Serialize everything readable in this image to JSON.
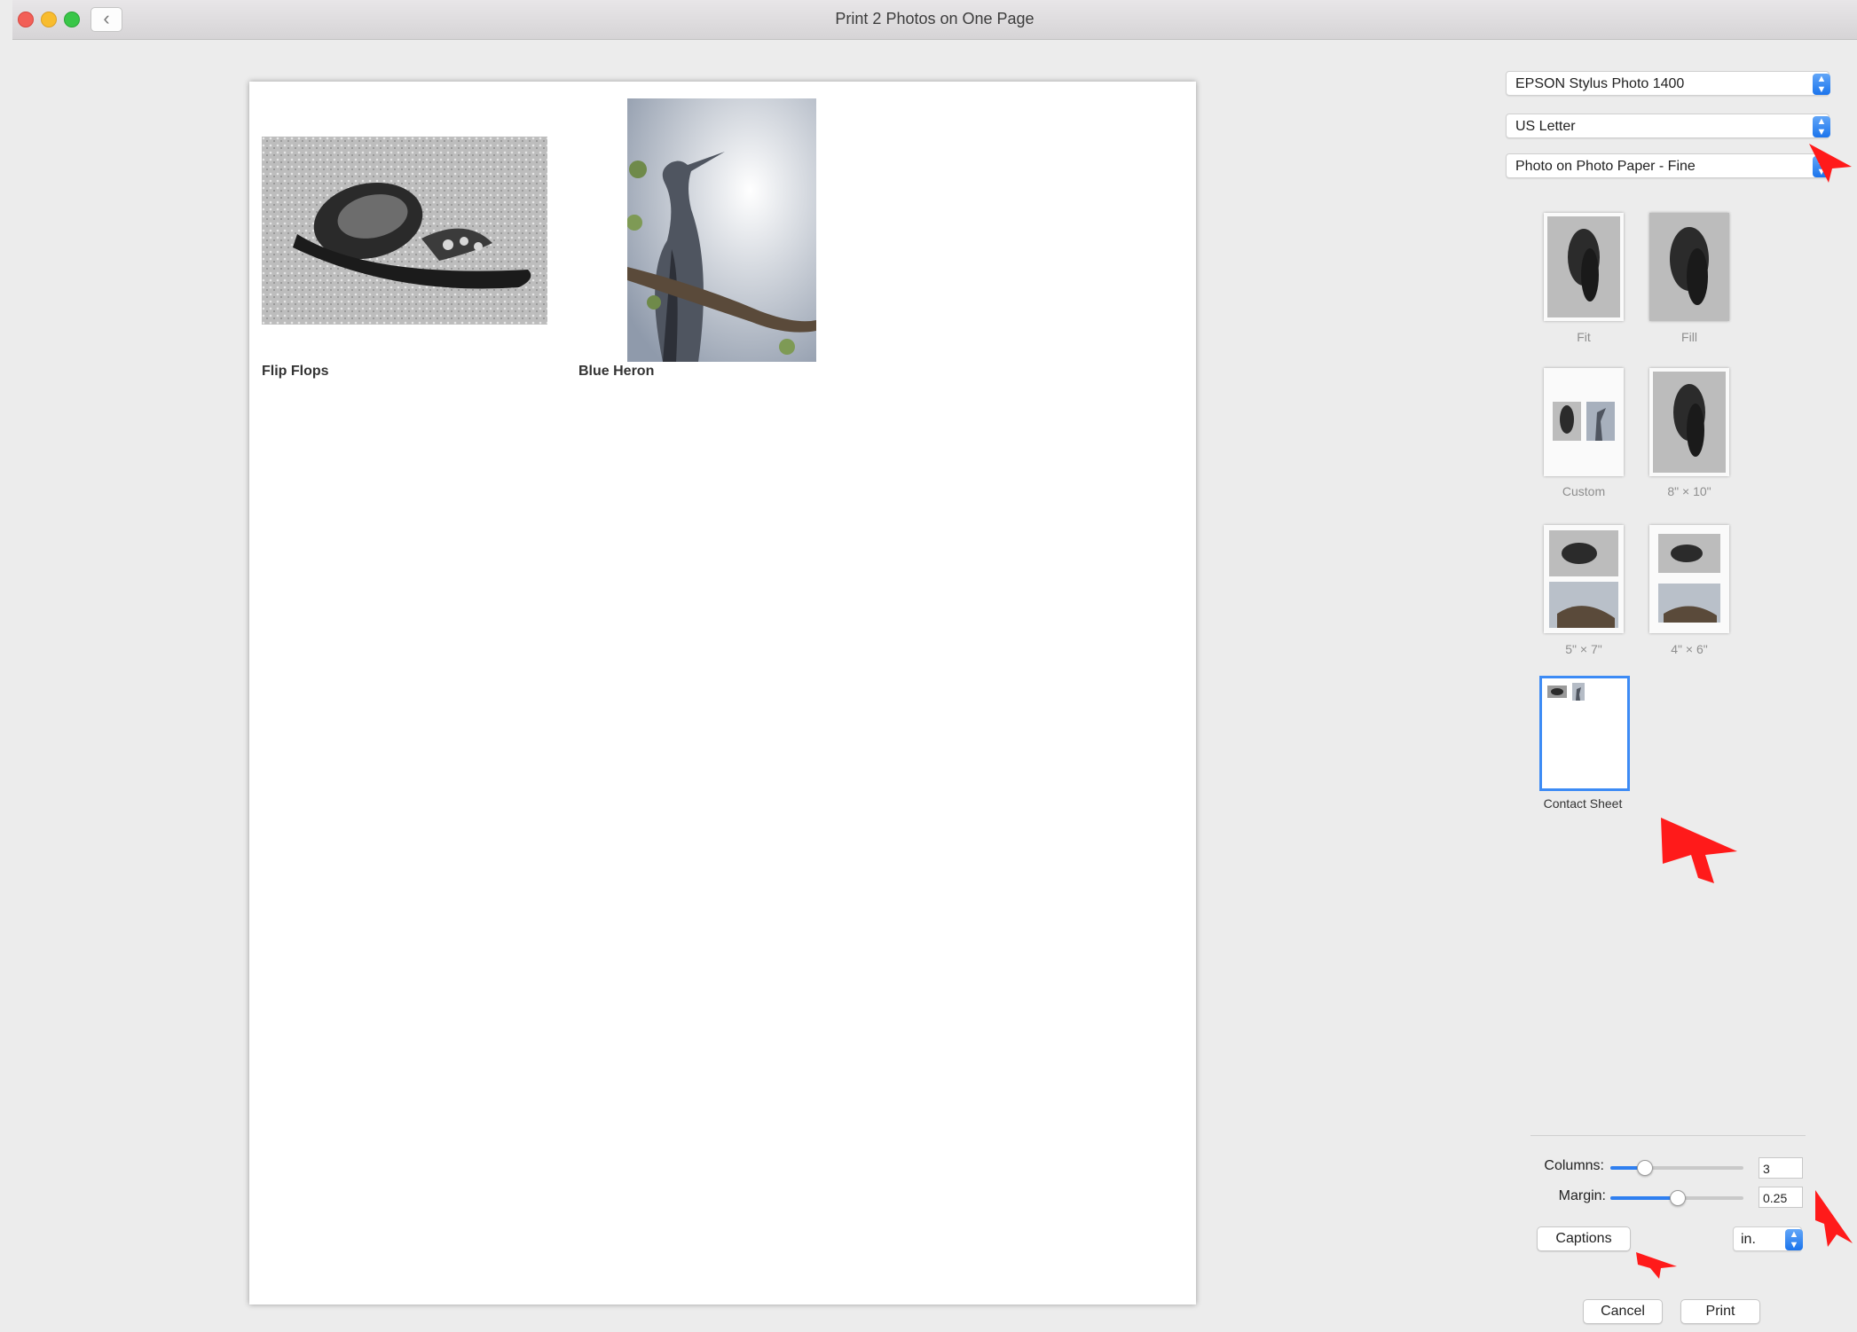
{
  "window": {
    "title": "Print 2 Photos on One Page"
  },
  "preview": {
    "photos": [
      {
        "caption": "Flip Flops"
      },
      {
        "caption": "Blue Heron"
      }
    ]
  },
  "settings": {
    "printer": "EPSON Stylus Photo 1400",
    "paper_size": "US Letter",
    "quality": "Photo on Photo Paper - Fine"
  },
  "layouts": [
    {
      "label": "Fit",
      "selected": false
    },
    {
      "label": "Fill",
      "selected": false
    },
    {
      "label": "Custom",
      "selected": false
    },
    {
      "label": "8\" × 10\"",
      "selected": false
    },
    {
      "label": "5\" × 7\"",
      "selected": false
    },
    {
      "label": "4\" × 6\"",
      "selected": false
    },
    {
      "label": "Contact Sheet",
      "selected": true
    }
  ],
  "controls": {
    "columns_label": "Columns:",
    "columns_value": "3",
    "columns_slider": 0.25,
    "margin_label": "Margin:",
    "margin_value": "0.25",
    "margin_slider": 0.5,
    "captions_button": "Captions",
    "units": "in."
  },
  "buttons": {
    "cancel": "Cancel",
    "print": "Print"
  },
  "colors": {
    "accent": "#2f7ff0",
    "annotation_arrow": "#ff1a1a"
  },
  "icons": [
    "close-icon",
    "minimize-icon",
    "zoom-icon",
    "back-chevron-icon",
    "stepper-icon",
    "red-arrow-annotation"
  ]
}
